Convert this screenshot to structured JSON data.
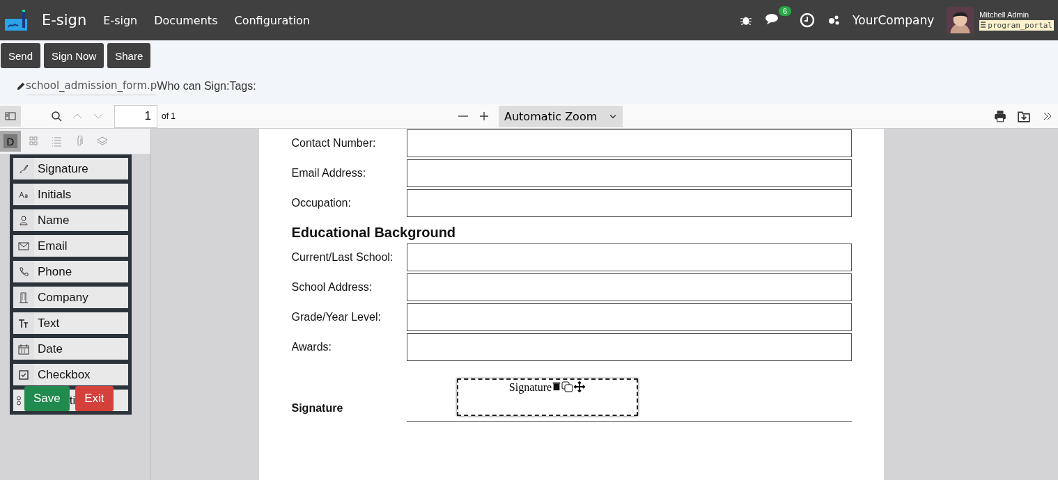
{
  "navbar": {
    "app_title": "E-sign",
    "menu": [
      "E-sign",
      "Documents",
      "Configuration"
    ],
    "message_count": "6",
    "company": "YourCompany",
    "user_name": "Mitchell Admin",
    "database": "program_portal"
  },
  "actions": [
    "Send",
    "Sign Now",
    "Share"
  ],
  "document": {
    "filename": "school_admission_form.p",
    "who_can_sign": "Who can Sign:",
    "tags": "Tags:"
  },
  "pdf_toolbar": {
    "page": "1",
    "page_count": "of 1",
    "zoom": "Automatic Zoom"
  },
  "sidebar_tabs": [
    {
      "kind": "letter",
      "label": "D",
      "selected": true
    },
    {
      "kind": "grid",
      "selected": false
    },
    {
      "kind": "list",
      "selected": false
    },
    {
      "kind": "clip",
      "selected": false
    },
    {
      "kind": "layers",
      "selected": false
    }
  ],
  "field_types": [
    {
      "kind": "signature",
      "label": "Signature"
    },
    {
      "kind": "initials",
      "label": "Initials"
    },
    {
      "kind": "name",
      "label": "Name"
    },
    {
      "kind": "email",
      "label": "Email"
    },
    {
      "kind": "phone",
      "label": "Phone"
    },
    {
      "kind": "company",
      "label": "Company"
    },
    {
      "kind": "text",
      "label": "Text"
    },
    {
      "kind": "date",
      "label": "Date"
    },
    {
      "kind": "checkbox",
      "label": "Checkbox"
    },
    {
      "kind": "selection",
      "label": "ti"
    }
  ],
  "palette_buttons": {
    "save": "Save",
    "exit": "Exit"
  },
  "form": [
    {
      "kind": "field",
      "label": "Contact Number:"
    },
    {
      "kind": "field",
      "label": "Email Address:"
    },
    {
      "kind": "field",
      "label": "Occupation:"
    },
    {
      "kind": "heading",
      "label": "Educational Background"
    },
    {
      "kind": "field",
      "label": "Current/Last School:"
    },
    {
      "kind": "field",
      "label": "School Address:"
    },
    {
      "kind": "field",
      "label": "Grade/Year Level:"
    },
    {
      "kind": "field",
      "label": "Awards:"
    },
    {
      "kind": "signature",
      "label": "Signature",
      "placeholder": "Signature"
    }
  ]
}
